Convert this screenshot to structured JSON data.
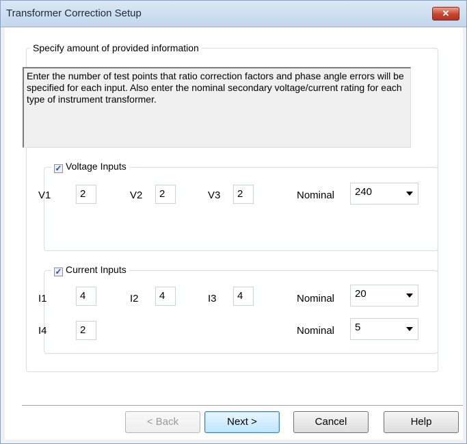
{
  "window": {
    "title": "Transformer Correction Setup",
    "close_glyph": "✕"
  },
  "outer_group": {
    "legend": "Specify amount of provided information",
    "info_text": "Enter the number of test points that ratio correction factors and phase angle errors will be specified for each input.  Also enter the nominal secondary voltage/current rating for each type of instrument transformer."
  },
  "voltage_group": {
    "checkbox_label": "Voltage Inputs",
    "checked": true,
    "fields": [
      {
        "label": "V1",
        "value": "2"
      },
      {
        "label": "V2",
        "value": "2"
      },
      {
        "label": "V3",
        "value": "2"
      }
    ],
    "nominal_label": "Nominal",
    "nominal_value": "240"
  },
  "current_group": {
    "checkbox_label": "Current Inputs",
    "checked": true,
    "fields": [
      {
        "label": "I1",
        "value": "4"
      },
      {
        "label": "I2",
        "value": "4"
      },
      {
        "label": "I3",
        "value": "4"
      },
      {
        "label": "I4",
        "value": "2"
      }
    ],
    "nominal_label": "Nominal",
    "nominal_value": "20",
    "nominal2_label": "Nominal",
    "nominal2_value": "5"
  },
  "buttons": {
    "back": "< Back",
    "next": "Next >",
    "cancel": "Cancel",
    "help": "Help"
  },
  "colors": {
    "titlebar": "#c3d6ec",
    "close_button": "#c8452e",
    "default_button": "#bde6fd",
    "check_mark": "#2a4aa0"
  }
}
